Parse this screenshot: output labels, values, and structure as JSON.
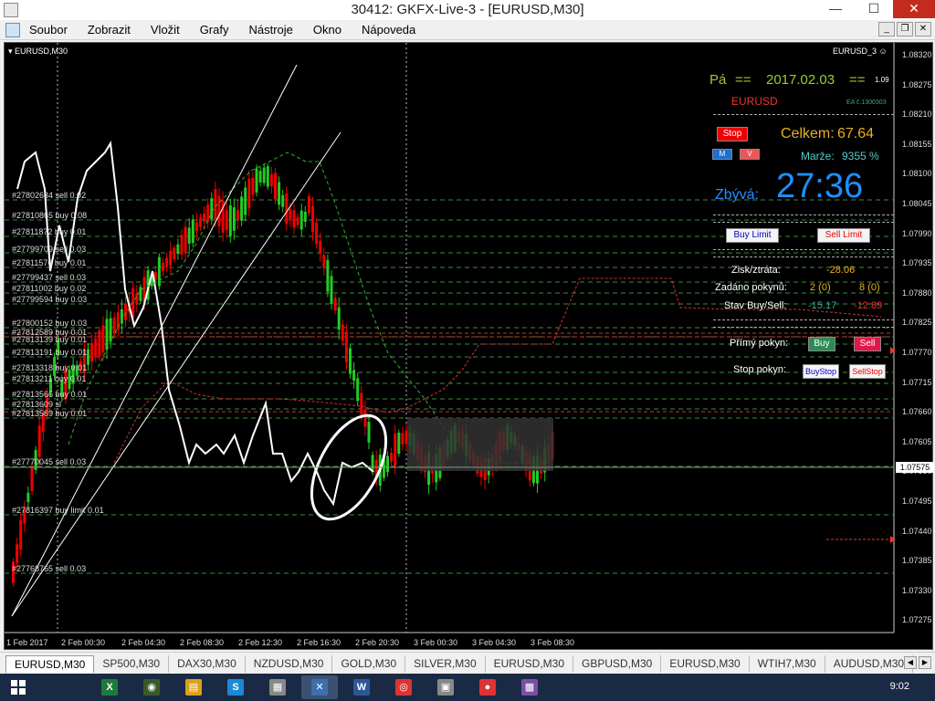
{
  "window": {
    "title": "30412: GKFX-Live-3 - [EURUSD,M30]",
    "minimize": "—",
    "maximize": "☐",
    "close": "✕"
  },
  "menu": {
    "items": [
      "Soubor",
      "Zobrazit",
      "Vložit",
      "Grafy",
      "Nástroje",
      "Okno",
      "Nápoveda"
    ],
    "mdi_buttons": [
      "_",
      "❐",
      "✕"
    ]
  },
  "chart": {
    "symbol_label": "▾ EURUSD,M30",
    "ea_name": "EURUSD_3 ☺",
    "price_axis": [
      "1.08320",
      "1.08275",
      "1.08210",
      "1.08155",
      "1.08100",
      "1.08045",
      "1.07990",
      "1.07935",
      "1.07880",
      "1.07825",
      "1.07770",
      "1.07715",
      "1.07660",
      "1.07605",
      "1.07550",
      "1.07495",
      "1.07440",
      "1.07385",
      "1.07330",
      "1.07275"
    ],
    "current_price": "1.07575",
    "time_axis": [
      "1 Feb 2017",
      "2 Feb 00:30",
      "2 Feb 04:30",
      "2 Feb 08:30",
      "2 Feb 12:30",
      "2 Feb 16:30",
      "2 Feb 20:30",
      "3 Feb 00:30",
      "3 Feb 04:30",
      "3 Feb 08:30"
    ],
    "order_labels": [
      "#27802634 sell 0.02",
      "#27810865 buy 0.08",
      "#27811872 buy 0.01",
      "#27799709 sell 0.03",
      "#27811576 buy 0.01",
      "#27799437 sell 0.03",
      "#27811002 buy 0.02",
      "#27799594 buy 0.03",
      "#27800152 buy 0.03",
      "#27812589 buy 0.01",
      "#27813139 buy 0.01",
      "#27813191 buy 0.01",
      "#27813318 buy 0.01",
      "#27813211 buy 0.01",
      "#27813566 buy 0.01",
      "#27813609 sl",
      "#27813569 buy 0.01",
      "#27770045 sell 0.03",
      "#27816397 buy limit 0.01",
      "#27768765 sell 0.03"
    ]
  },
  "ea_panel": {
    "day": "Pá",
    "eq1": "==",
    "date": "2017.02.03",
    "eq2": "==",
    "version": "1.09",
    "symbol": "EURUSD",
    "ea_number": "EA č.1300303",
    "stop_button": "Stop",
    "mini_buttons": [
      "M",
      "V"
    ],
    "total_label": "Celkem:",
    "total_value": "67.64",
    "margin_label": "Marže:",
    "margin_value": "9355 %",
    "remaining_label": "Zbývá:",
    "remaining_value": "27:36",
    "buy_limit": "Buy Limit",
    "sell_limit": "Sell Limit",
    "profit_label": "Zisk/ztráta:",
    "profit_value": "-28.06",
    "orders_label": "Zadáno pokynů:",
    "orders_buy": "2 (0)",
    "orders_sell": "8 (0)",
    "state_label": "Stav Buy/Sell:",
    "state_buy": "-15.17",
    "state_sell": "-12.89",
    "direct_label": "Přímý pokyn:",
    "buy": "Buy",
    "sell": "Sell",
    "stop_order_label": "Stop pokyn:",
    "buy_stop": "BuyStop",
    "sell_stop": "SellStop"
  },
  "tabs": {
    "items": [
      "EURUSD,M30",
      "SP500,M30",
      "DAX30,M30",
      "NZDUSD,M30",
      "GOLD,M30",
      "SILVER,M30",
      "EURUSD,M30",
      "GBPUSD,M30",
      "EURUSD,M30",
      "WTIH7,M30",
      "AUDUSD,M30"
    ],
    "nav": [
      "◀",
      "▶"
    ]
  },
  "taskbar": {
    "apps": [
      {
        "name": "excel",
        "glyph": "X",
        "color": "#1d7a3a"
      },
      {
        "name": "app-globe",
        "glyph": "◉",
        "color": "#3a5a2a"
      },
      {
        "name": "file-explorer",
        "glyph": "▤",
        "color": "#d9a21b"
      },
      {
        "name": "skype",
        "glyph": "S",
        "color": "#1a8ad4"
      },
      {
        "name": "paint",
        "glyph": "▦",
        "color": "#888"
      },
      {
        "name": "metatrader",
        "glyph": "✕",
        "color": "#3b6fb0"
      },
      {
        "name": "word",
        "glyph": "W",
        "color": "#2b5797"
      },
      {
        "name": "chrome",
        "glyph": "◎",
        "color": "#d33"
      },
      {
        "name": "windows-store",
        "glyph": "▣",
        "color": "#888"
      },
      {
        "name": "app-dots",
        "glyph": "●",
        "color": "#d33"
      },
      {
        "name": "app-image",
        "glyph": "▩",
        "color": "#7a4fa3"
      }
    ],
    "clock": "9:02"
  }
}
